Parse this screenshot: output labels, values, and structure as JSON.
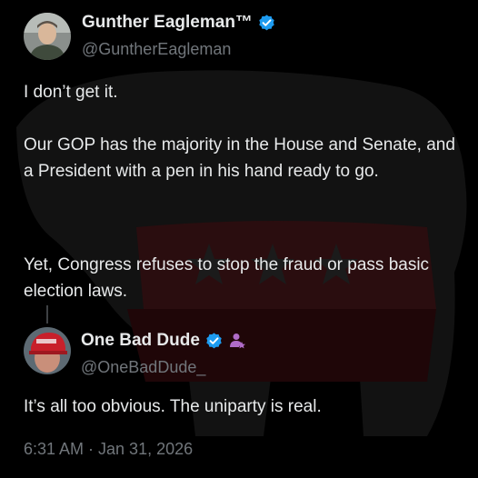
{
  "main_tweet": {
    "display_name": "Gunther Eagleman™",
    "handle": "@GuntherEagleman",
    "paragraphs": [
      "I don’t get it.",
      "Our GOP has the majority in the House and Senate, and a President with a pen in his hand ready to go.",
      "Yet, Congress refuses to stop the fraud or pass basic election laws."
    ],
    "verified_icon": "verified-badge-icon"
  },
  "reply_tweet": {
    "display_name": "One Bad Dude",
    "handle": "@OneBadDude_",
    "text": "It’s all too obvious.  The uniparty is real.",
    "verified_icon": "verified-badge-icon",
    "affiliate_icon": "affiliate-person-icon",
    "timestamp": "6:31 AM · Jan 31, 2026"
  },
  "colors": {
    "background": "#000000",
    "text": "#e7e9ea",
    "secondary_text": "#71767b",
    "verified_blue": "#1d9bf0",
    "affiliate_purple": "#b06cc8"
  }
}
